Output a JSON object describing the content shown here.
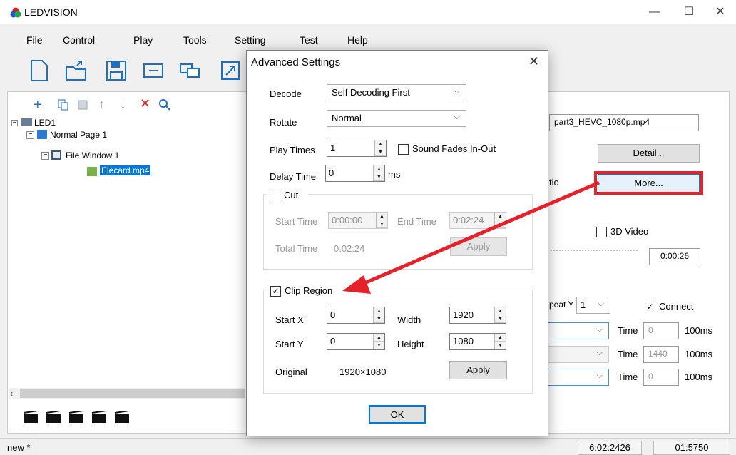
{
  "app": {
    "title": "LEDVISION"
  },
  "window": {
    "minimize": "—",
    "maximize": "☐",
    "close": "✕"
  },
  "menu": [
    "File",
    "Control",
    "Play",
    "Tools",
    "Setting",
    "Test",
    "Help"
  ],
  "tree": {
    "root": "LED1",
    "page": "Normal Page 1",
    "window": "File Window 1",
    "file": "Elecard.mp4"
  },
  "right": {
    "filename": "part3_HEVC_1080p.mp4",
    "detail_btn": "Detail...",
    "ratio_label": "tio",
    "more_btn": "More...",
    "video3d_label": "3D Video",
    "time_value": "0:00:26",
    "repeat_label": "peat Y",
    "repeat_value": "1",
    "connect_label": "Connect",
    "time_label": "Time",
    "unit": "100ms",
    "times": [
      "0",
      "1440",
      "0"
    ]
  },
  "status": {
    "left": "new *",
    "box1": "6:02:2426",
    "box2": "01:5750"
  },
  "dialog": {
    "title": "Advanced Settings",
    "decode_label": "Decode",
    "decode_value": "Self Decoding First",
    "rotate_label": "Rotate",
    "rotate_value": "Normal",
    "playtimes_label": "Play Times",
    "playtimes_value": "1",
    "sound_fades_label": "Sound Fades In-Out",
    "delay_label": "Delay Time",
    "delay_value": "0",
    "delay_unit": "ms",
    "cut_label": "Cut",
    "start_time_label": "Start Time",
    "start_time_value": "0:00:00",
    "end_time_label": "End Time",
    "end_time_value": "0:02:24",
    "total_time_label": "Total Time",
    "total_time_value": "0:02:24",
    "apply": "Apply",
    "clip_label": "Clip Region",
    "startx_label": "Start X",
    "startx_value": "0",
    "width_label": "Width",
    "width_value": "1920",
    "starty_label": "Start Y",
    "starty_value": "0",
    "height_label": "Height",
    "height_value": "1080",
    "original_label": "Original",
    "original_value": "1920×1080",
    "ok": "OK"
  },
  "annotation_color": "#e5222a"
}
